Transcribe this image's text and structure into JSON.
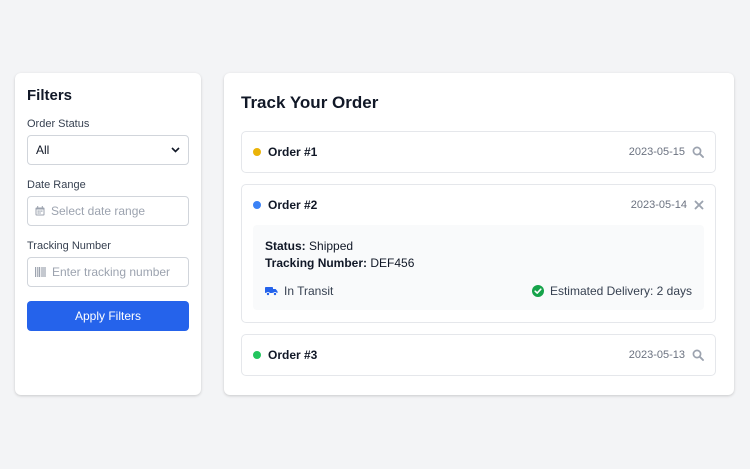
{
  "filters": {
    "title": "Filters",
    "status_label": "Order Status",
    "status_value": "All",
    "date_label": "Date Range",
    "date_placeholder": "Select date range",
    "tracking_label": "Tracking Number",
    "tracking_placeholder": "Enter tracking number",
    "apply_label": "Apply Filters"
  },
  "main": {
    "title": "Track Your Order",
    "orders": [
      {
        "title": "Order #1",
        "date": "2023-05-15",
        "status_color": "#eab308",
        "action_icon": "search-icon"
      },
      {
        "title": "Order #2",
        "date": "2023-05-14",
        "status_color": "#3b82f6",
        "action_icon": "close-icon",
        "details": {
          "status_label": "Status:",
          "status_value": "Shipped",
          "tracking_label": "Tracking Number:",
          "tracking_value": "DEF456",
          "transit_text": "In Transit",
          "delivery_text": "Estimated Delivery: 2 days"
        }
      },
      {
        "title": "Order #3",
        "date": "2023-05-13",
        "status_color": "#22c55e",
        "action_icon": "search-icon"
      }
    ]
  },
  "colors": {
    "accent": "#2563eb",
    "truck": "#2563eb",
    "check": "#16a34a"
  }
}
